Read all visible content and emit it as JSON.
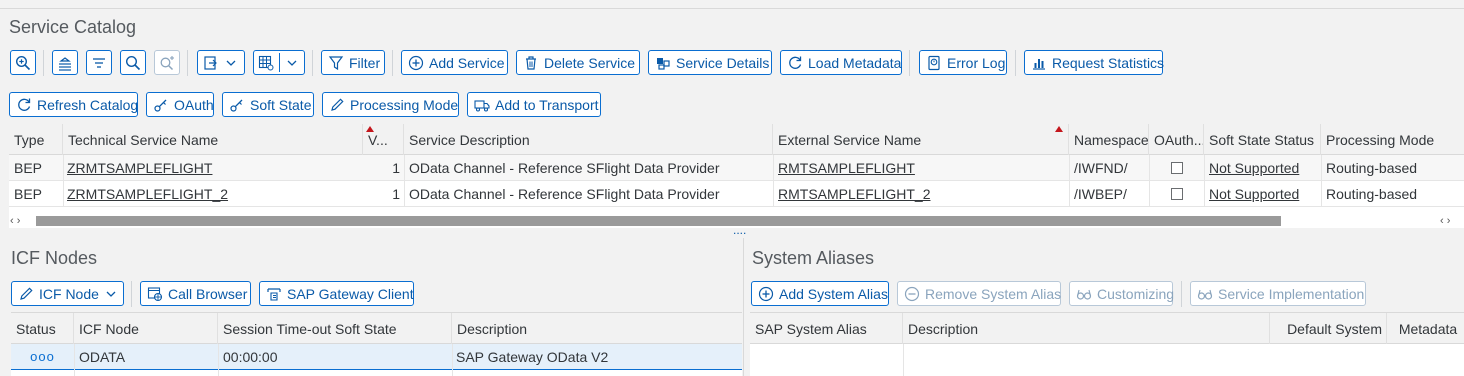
{
  "catalog": {
    "title": "Service Catalog",
    "toolbar1": {
      "filter": "Filter",
      "add_service": "Add Service",
      "delete_service": "Delete Service",
      "service_details": "Service Details",
      "load_metadata": "Load Metadata",
      "error_log": "Error Log",
      "request_statistics": "Request Statistics"
    },
    "toolbar2": {
      "refresh_catalog": "Refresh Catalog",
      "oauth": "OAuth",
      "soft_state": "Soft State",
      "processing_mode": "Processing Mode",
      "add_to_transport": "Add to Transport"
    },
    "columns": [
      "Type",
      "Technical Service Name",
      "V...",
      "Service Description",
      "External Service Name",
      "Namespace",
      "OAuth...",
      "Soft State Status",
      "Processing Mode"
    ],
    "rows": [
      {
        "type": "BEP",
        "tech_name": "ZRMTSAMPLEFLIGHT",
        "version": "1",
        "description": "OData Channel - Reference SFlight Data Provider",
        "ext_name": "RMTSAMPLEFLIGHT",
        "namespace": "/IWFND/",
        "soft_state": "Not Supported",
        "processing_mode": "Routing-based"
      },
      {
        "type": "BEP",
        "tech_name": "ZRMTSAMPLEFLIGHT_2",
        "version": "1",
        "description": "OData Channel - Reference SFlight Data Provider",
        "ext_name": "RMTSAMPLEFLIGHT_2",
        "namespace": "/IWBEP/",
        "soft_state": "Not Supported",
        "processing_mode": "Routing-based"
      }
    ],
    "scroll": {
      "left": "‹ ›",
      "right": "‹ ›"
    }
  },
  "icf": {
    "title": "ICF Nodes",
    "icf_node_btn": "ICF Node",
    "call_browser": "Call Browser",
    "gateway_client": "SAP Gateway Client",
    "columns": [
      "Status",
      "ICF Node",
      "Session Time-out Soft State",
      "Description"
    ],
    "rows": [
      {
        "status": "ooo",
        "node": "ODATA",
        "timeout": "00:00:00",
        "description": "SAP Gateway OData V2"
      }
    ]
  },
  "aliases": {
    "title": "System Aliases",
    "add_alias": "Add System Alias",
    "remove_alias": "Remove System Alias",
    "customizing": "Customizing",
    "service_impl": "Service Implementation",
    "columns": [
      "SAP System Alias",
      "Description",
      "Default System",
      "Metadata"
    ]
  },
  "splitter_grip": "....",
  "colors": {
    "accent": "#0a6ed1",
    "sort_marker": "#c4161c",
    "status_icon": "#0a6ed1"
  }
}
